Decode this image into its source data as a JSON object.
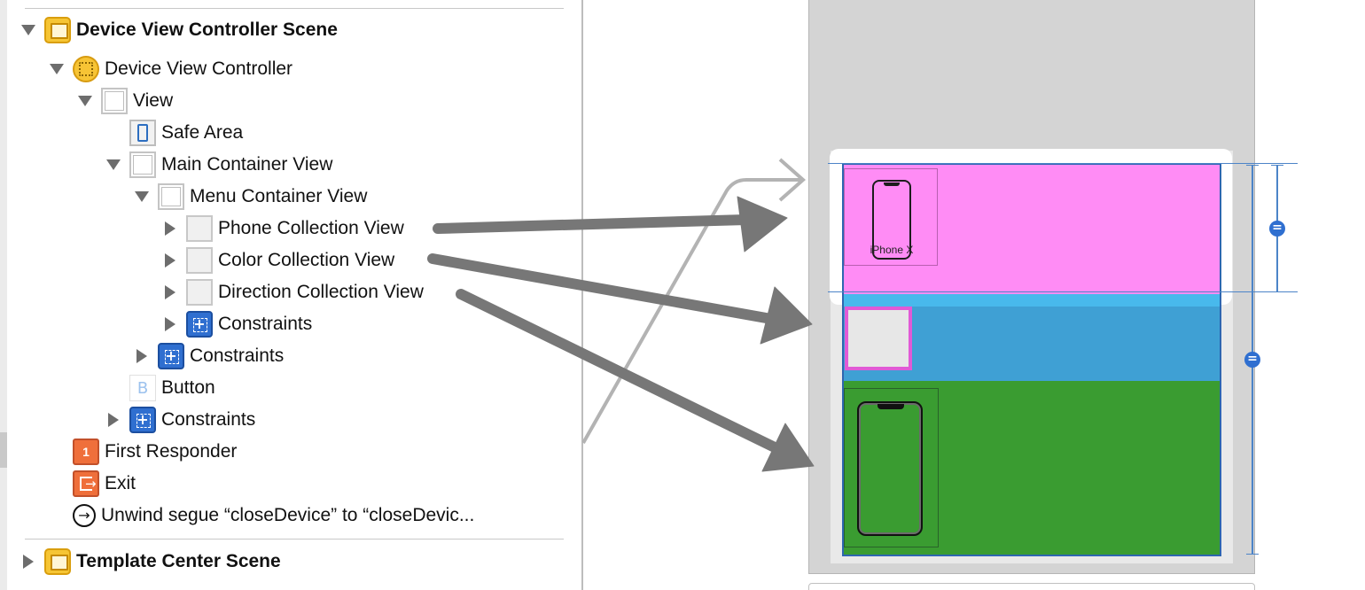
{
  "outline": {
    "scenes": [
      {
        "label": "Device View Controller Scene"
      },
      {
        "label": "Template Center Scene"
      }
    ],
    "rows": [
      {
        "label": "Device View Controller"
      },
      {
        "label": "View"
      },
      {
        "label": "Safe Area"
      },
      {
        "label": "Main Container View"
      },
      {
        "label": "Menu Container View"
      },
      {
        "label": "Phone Collection View"
      },
      {
        "label": "Color Collection View"
      },
      {
        "label": "Direction Collection View"
      },
      {
        "label": "Constraints"
      },
      {
        "label": "Constraints"
      },
      {
        "label": "Button"
      },
      {
        "label": "Constraints"
      },
      {
        "label": "First Responder"
      },
      {
        "label": "Exit"
      },
      {
        "label": "Unwind segue “closeDevice” to “closeDevic..."
      }
    ]
  },
  "canvas": {
    "phone_cell_caption": "iPhone X",
    "colors": {
      "phone_band": "#ff8cf5",
      "color_band": "#3fa0d4",
      "direction_band": "#3a9c31",
      "constraint_blue": "#2f6fd0",
      "callout_arrow": "#777777"
    }
  },
  "icons": [
    "scene-icon",
    "view-controller-icon",
    "view-icon",
    "safe-area-icon",
    "collection-view-icon",
    "constraints-icon",
    "button-icon",
    "first-responder-icon",
    "exit-icon",
    "unwind-segue-icon"
  ]
}
